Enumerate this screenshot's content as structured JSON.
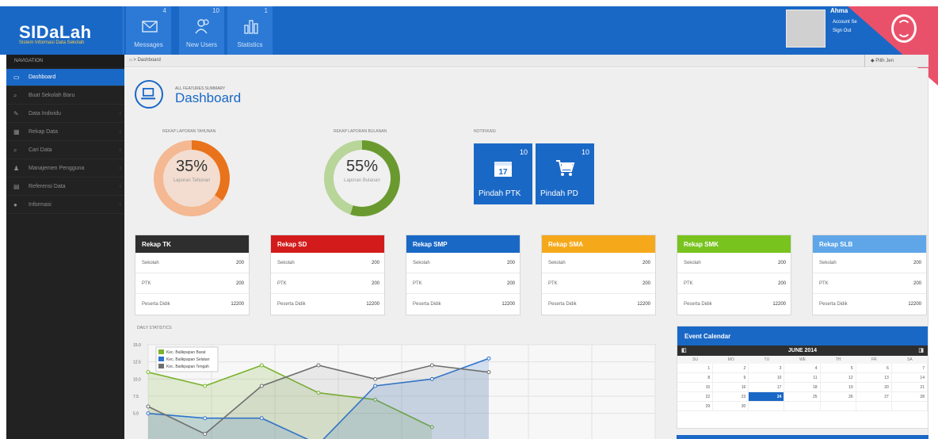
{
  "app": {
    "logo": "SIDaLah",
    "logo_sub": "Sistem Informasi Data Sekolah"
  },
  "topnav": [
    {
      "label": "Messages",
      "count": "4",
      "icon": "envelope-icon"
    },
    {
      "label": "New Users",
      "count": "10",
      "icon": "users-icon"
    },
    {
      "label": "Statistics",
      "count": "1",
      "icon": "bar-chart-icon"
    }
  ],
  "user": {
    "name": "Ahma",
    "account": "Account Se",
    "signout": "Sign Out"
  },
  "breadcrumb": "Dashboard",
  "lang": "Pilih Jen",
  "sidebar": {
    "heading": "NAVIGATION",
    "items": [
      {
        "label": "Dashboard",
        "icon": "▭",
        "active": true
      },
      {
        "label": "Buat Sekolah Baru",
        "icon": "⌕"
      },
      {
        "label": "Data Individu",
        "icon": "✎",
        "chev": true
      },
      {
        "label": "Rekap Data",
        "icon": "▦",
        "chev": true
      },
      {
        "label": "Cari Data",
        "icon": "⌕",
        "chev": true
      },
      {
        "label": "Manajemen Pengguna",
        "icon": "♟",
        "chev": true
      },
      {
        "label": "Referensi Data",
        "icon": "▤",
        "chev": true
      },
      {
        "label": "Informasi",
        "icon": "●",
        "chev": true
      }
    ]
  },
  "header": {
    "subtitle": "ALL FEATURES SUMMARY",
    "title": "Dashboard"
  },
  "summary": {
    "tahunan": {
      "label": "REKAP LAPORAN TAHUNAN",
      "percent": 35,
      "text": "35%",
      "caption": "Laporan Tahunan",
      "color": "#e8731c",
      "track": "#f4b892",
      "fill": "#f2ddd0"
    },
    "bulanan": {
      "label": "REKAP LAPORAN BULANAN",
      "percent": 55,
      "text": "55%",
      "caption": "Laporan Bulanan",
      "color": "#6a9a2f",
      "track": "#b8d59a",
      "fill": "#f0f0f0"
    }
  },
  "notifikasi": {
    "label": "NOTIFIKASI",
    "items": [
      {
        "label": "Pindah PTK",
        "count": "10",
        "icon": "calendar-icon",
        "glyph": "17"
      },
      {
        "label": "Pindah PD",
        "count": "10",
        "icon": "cart-icon",
        "glyph": "🛒"
      }
    ]
  },
  "rekap": [
    {
      "title": "Rekap TK",
      "color": "#2e2e2e",
      "rows": [
        {
          "k": "Sekolah",
          "v": "200"
        },
        {
          "k": "PTK",
          "v": "200"
        },
        {
          "k": "Peserta Didik",
          "v": "12200"
        }
      ]
    },
    {
      "title": "Rekap SD",
      "color": "#d31b1b",
      "rows": [
        {
          "k": "Sekolah",
          "v": "200"
        },
        {
          "k": "PTK",
          "v": "200"
        },
        {
          "k": "Peserta Didik",
          "v": "12200"
        }
      ]
    },
    {
      "title": "Rekap SMP",
      "color": "#1a68c6",
      "rows": [
        {
          "k": "Sekolah",
          "v": "200"
        },
        {
          "k": "PTK",
          "v": "200"
        },
        {
          "k": "Peserta Didik",
          "v": "12200"
        }
      ]
    },
    {
      "title": "Rekap SMA",
      "color": "#f5a91a",
      "rows": [
        {
          "k": "Sekolah",
          "v": "200"
        },
        {
          "k": "PTK",
          "v": "200"
        },
        {
          "k": "Peserta Didik",
          "v": "12200"
        }
      ]
    },
    {
      "title": "Rekap SMK",
      "color": "#79c31f",
      "rows": [
        {
          "k": "Sekolah",
          "v": "200"
        },
        {
          "k": "PTK",
          "v": "200"
        },
        {
          "k": "Peserta Didik",
          "v": "12200"
        }
      ]
    },
    {
      "title": "Rekap SLB",
      "color": "#5ea6e8",
      "rows": [
        {
          "k": "Sekolah",
          "v": "200"
        },
        {
          "k": "PTK",
          "v": "200"
        },
        {
          "k": "Peserta Didik",
          "v": "12200"
        }
      ]
    }
  ],
  "daily": {
    "label": "DAILY STATISTICS"
  },
  "chart_data": {
    "type": "line",
    "title": "",
    "xlabel": "",
    "ylabel": "",
    "ylim": [
      0,
      15
    ],
    "yticks": [
      "15.0",
      "12.5",
      "10.0",
      "7.5",
      "5.0"
    ],
    "x": [
      0,
      1,
      2,
      3,
      4,
      5,
      6
    ],
    "series": [
      {
        "name": "Kec. Balikpapan Barat",
        "color": "#7ab32e",
        "values": [
          11,
          9,
          12,
          8,
          7,
          3,
          null
        ]
      },
      {
        "name": "Kec. Balikpapan Selatan",
        "color": "#2a73cf",
        "values": [
          5,
          4.3,
          4.3,
          0.5,
          9,
          10,
          13
        ]
      },
      {
        "name": "Kec. Balikpapan Tengah",
        "color": "#6f6f6f",
        "values": [
          6,
          2,
          9,
          12,
          10,
          12,
          11
        ]
      }
    ],
    "legend": "top-left",
    "grid": true
  },
  "calendar": {
    "title": "Event Calendar",
    "month": "JUNE 2014",
    "days": [
      "SU",
      "MO",
      "TU",
      "WE",
      "TH",
      "FR",
      "SA"
    ],
    "weeks": [
      [
        "",
        "",
        "",
        "",
        "",
        "",
        ""
      ],
      [
        "1",
        "2",
        "3",
        "4",
        "5",
        "6",
        "7"
      ],
      [
        "8",
        "9",
        "10",
        "11",
        "12",
        "13",
        "14"
      ],
      [
        "15",
        "16",
        "17",
        "18",
        "19",
        "20",
        "21"
      ],
      [
        "22",
        "23",
        "24",
        "25",
        "26",
        "27",
        "28"
      ],
      [
        "29",
        "30",
        "",
        "",
        "",
        "",
        ""
      ]
    ],
    "today": "24"
  }
}
